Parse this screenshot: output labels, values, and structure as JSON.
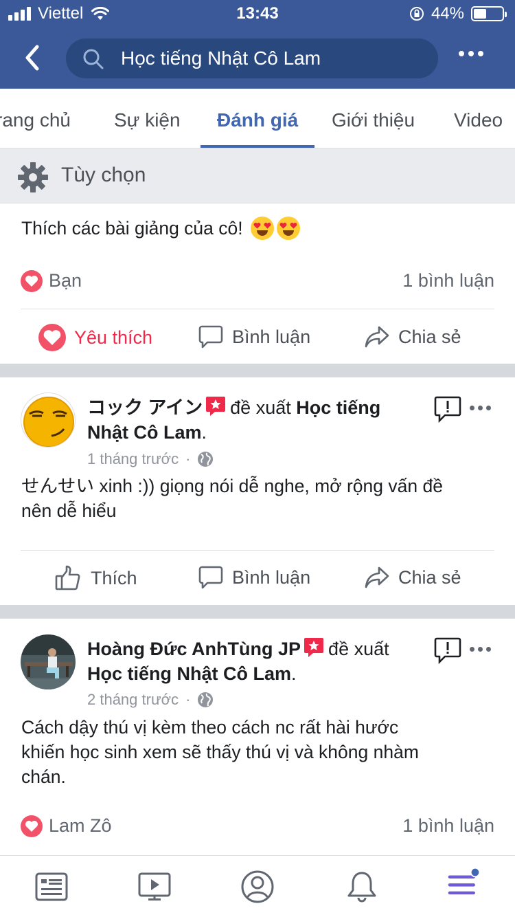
{
  "status_bar": {
    "carrier": "Viettel",
    "time": "13:43",
    "battery": "44%",
    "battery_level": 0.44
  },
  "header": {
    "search_text": "Học tiếng Nhật Cô Lam"
  },
  "tabs": [
    {
      "label": "rang chủ"
    },
    {
      "label": "Sự kiện"
    },
    {
      "label": "Đánh giá",
      "active": true
    },
    {
      "label": "Giới thiệu"
    },
    {
      "label": "Video"
    }
  ],
  "options": {
    "label": "Tùy chọn"
  },
  "post1": {
    "text": "Thích các bài giảng của cô!",
    "emojis": [
      "heart-eyes-emoji",
      "heart-eyes-emoji"
    ],
    "reaction_name": "Bạn",
    "comment_count": "1 bình luận",
    "actions": {
      "like": "Yêu thích",
      "comment": "Bình luận",
      "share": "Chia sẻ"
    }
  },
  "post2": {
    "author": "コック アイン",
    "verb": "đề xuất",
    "page": "Học tiếng Nhật Cô Lam",
    "time": "1 tháng trước",
    "text_line1": "せんせい xinh :)) giọng nói dễ nghe, mở rộng vấn đề",
    "text_line2": "nên dễ hiểu",
    "actions": {
      "like": "Thích",
      "comment": "Bình luận",
      "share": "Chia sẻ"
    }
  },
  "post3": {
    "author": "Hoàng Đức AnhTùng JP",
    "verb": "đề xuất",
    "page": "Học tiếng Nhật Cô Lam",
    "time": "2 tháng trước",
    "text_line1": "Cách dậy thú vị kèm theo cách nc rất hài hước",
    "text_line2": "khiến học sinh xem sẽ thấy thú vị và không nhàm",
    "text_line3": "chán.",
    "reaction_name": "Lam Zô",
    "comment_count": "1 bình luận"
  },
  "bottom_nav": [
    "news-feed-icon",
    "watch-icon",
    "profile-icon",
    "notifications-icon",
    "menu-icon"
  ],
  "colors": {
    "brand": "#3b5998",
    "accent": "#4267b2",
    "love": "#f25268",
    "divider": "#d5d8dd"
  }
}
